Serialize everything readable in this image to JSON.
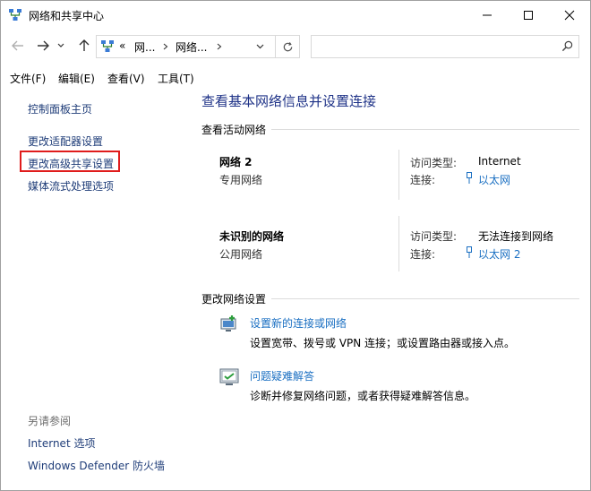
{
  "window": {
    "title": "网络和共享中心"
  },
  "address": {
    "overflow": "«",
    "crumb1": "网...",
    "crumb2": "网络...",
    "search_placeholder": ""
  },
  "menu": [
    "文件(F)",
    "编辑(E)",
    "查看(V)",
    "工具(T)"
  ],
  "sidebar": {
    "items": [
      "控制面板主页",
      "更改适配器设置",
      "更改高级共享设置",
      "媒体流式处理选项"
    ],
    "see_also_label": "另请参阅",
    "see_also": [
      "Internet 选项",
      "Windows Defender 防火墙"
    ]
  },
  "main": {
    "title": "查看基本网络信息并设置连接",
    "active_networks_label": "查看活动网络",
    "networks": [
      {
        "name": "网络 2",
        "type": "专用网络",
        "access_label": "访问类型:",
        "access_value": "Internet",
        "conn_label": "连接:",
        "conn_value": "以太网"
      },
      {
        "name": "未识别的网络",
        "type": "公用网络",
        "access_label": "访问类型:",
        "access_value": "无法连接到网络",
        "conn_label": "连接:",
        "conn_value": "以太网 2"
      }
    ],
    "change_settings_label": "更改网络设置",
    "tasks": [
      {
        "title": "设置新的连接或网络",
        "desc": "设置宽带、拨号或 VPN 连接；或设置路由器或接入点。",
        "icon": "new-connection-icon"
      },
      {
        "title": "问题疑难解答",
        "desc": "诊断并修复网络问题，或者获得疑难解答信息。",
        "icon": "troubleshoot-icon"
      }
    ]
  },
  "colors": {
    "link": "#1e3c78",
    "accent_link": "#1a6fc2",
    "title": "#1e3287",
    "highlight": "#e01c1c"
  }
}
